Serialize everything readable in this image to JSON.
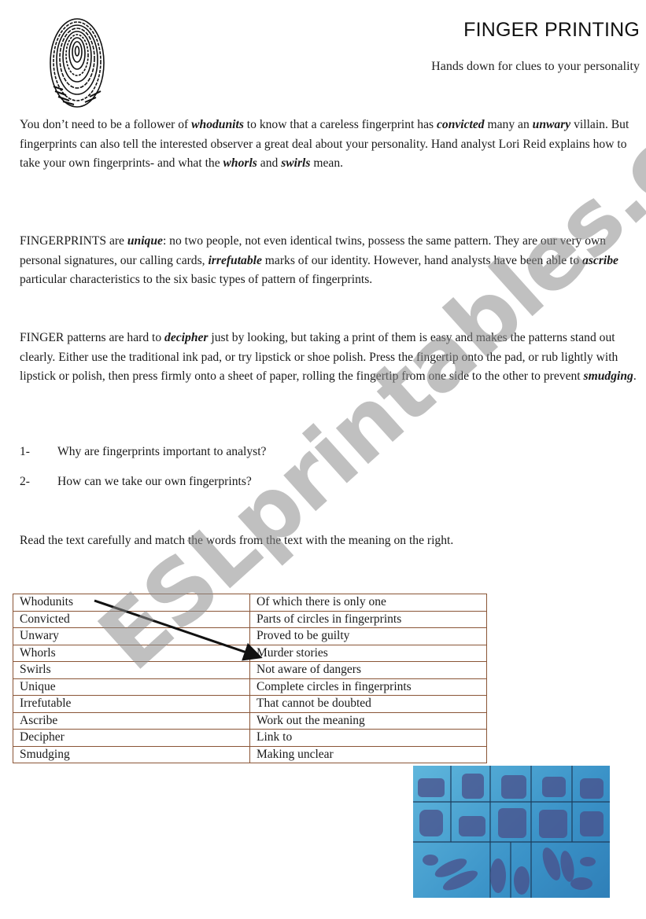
{
  "header": {
    "title": "FINGER PRINTING",
    "subtitle": "Hands down for clues to your personality",
    "logo_icon": "fingerprint-icon"
  },
  "paragraphs": [
    {
      "segments": [
        {
          "text": "You don’t need to be a follower of ",
          "em": false
        },
        {
          "text": "whodunits",
          "em": true
        },
        {
          "text": " to know that a careless fingerprint has ",
          "em": false
        },
        {
          "text": "convicted",
          "em": true
        },
        {
          "text": " many an ",
          "em": false
        },
        {
          "text": "unwary",
          "em": true
        },
        {
          "text": " villain. But fingerprints can also tell the interested observer a great deal about your personality. Hand analyst Lori Reid explains how to take your own fingerprints- and what the ",
          "em": false
        },
        {
          "text": "whorls",
          "em": true
        },
        {
          "text": " and ",
          "em": false
        },
        {
          "text": "swirls",
          "em": true
        },
        {
          "text": " mean.",
          "em": false
        }
      ]
    },
    {
      "segments": [
        {
          "text": "FINGERPRINTS are ",
          "em": false
        },
        {
          "text": "unique",
          "em": true
        },
        {
          "text": ": no two people, not even identical twins, possess the same pattern. They are our very own personal signatures, our calling cards, ",
          "em": false
        },
        {
          "text": "irrefutable",
          "em": true
        },
        {
          "text": " marks of our identity. However, hand analysts have been able to ",
          "em": false
        },
        {
          "text": "ascribe",
          "em": true
        },
        {
          "text": " particular characteristics to the six basic types of pattern of fingerprints.",
          "em": false
        }
      ]
    },
    {
      "segments": [
        {
          "text": "FINGER patterns are hard to ",
          "em": false
        },
        {
          "text": "decipher",
          "em": true
        },
        {
          "text": " just by looking, but taking a print of them is easy and makes the patterns stand out clearly. Either use the traditional ink pad, or try lipstick or shoe polish. Press the fingertip onto the pad, or rub lightly with lipstick or polish, then press firmly onto a sheet of paper, rolling the fingertip from one side to the other to prevent ",
          "em": false
        },
        {
          "text": "smudging",
          "em": true
        },
        {
          "text": ".",
          "em": false
        }
      ]
    }
  ],
  "questions": [
    {
      "num": "1-",
      "text": "Why are fingerprints important to analyst?"
    },
    {
      "num": "2-",
      "text": "How can we take our own fingerprints?"
    }
  ],
  "instruction": "Read the text carefully and match the words from the text with the meaning on the right.",
  "matching_table": {
    "rows": [
      {
        "word": "Whodunits",
        "meaning": "Of which there is only one"
      },
      {
        "word": "Convicted",
        "meaning": "Parts of circles in fingerprints"
      },
      {
        "word": "Unwary",
        "meaning": "Proved to be guilty"
      },
      {
        "word": "Whorls",
        "meaning": "Murder stories"
      },
      {
        "word": "Swirls",
        "meaning": "Not aware of dangers"
      },
      {
        "word": "Unique",
        "meaning": "Complete circles in fingerprints"
      },
      {
        "word": "Irrefutable",
        "meaning": "That cannot be doubted"
      },
      {
        "word": "Ascribe",
        "meaning": "Work out the meaning"
      },
      {
        "word": "Decipher",
        "meaning": "Link to"
      },
      {
        "word": "Smudging",
        "meaning": "Making unclear"
      }
    ],
    "example_match": {
      "word": "Whodunits",
      "meaning": "Murder stories"
    },
    "border_color": "#8a5536"
  },
  "watermark": "ESLprintables.com",
  "photo": {
    "description": "fingerprint record card",
    "tint": "#3b93c8"
  }
}
